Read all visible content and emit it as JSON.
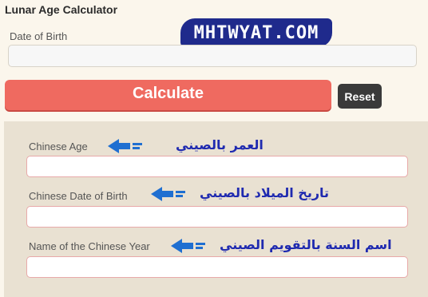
{
  "calculator": {
    "title": "Lunar Age Calculator",
    "dob_label": "Date of Birth",
    "dob_value": "",
    "calculate_label": "Calculate",
    "reset_label": "Reset"
  },
  "watermark": {
    "text": "MHTWYAT.COM"
  },
  "results": [
    {
      "label": "Chinese Age",
      "value": "",
      "annotation": "العمر بالصيني"
    },
    {
      "label": "Chinese Date of Birth",
      "value": "",
      "annotation": "تاريخ الميلاد بالصيني"
    },
    {
      "label": "Name of the Chinese Year",
      "value": "",
      "annotation": "اسم السنة بالتقويم الصيني"
    }
  ],
  "colors": {
    "calculate": "#ef6a60",
    "reset": "#3a3a3a",
    "annotation": "#1f2ab0",
    "arrow": "#1f6fd1"
  },
  "icons": {
    "annotation_arrow": "left-arrow-icon"
  }
}
